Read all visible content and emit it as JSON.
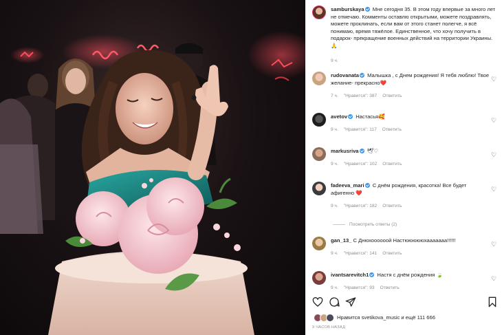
{
  "post": {
    "author": {
      "username": "samburskaya",
      "caption": "Мне сегодня 35. В этом году впервые за много лет не отмечаю. Комменты оставлю открытыми, можете поздравлять, можете проклинать, если вам от этого станет полегче, я всё понимаю, время тяжёлое. Единственное, что хочу получить в подарок- прекращение военных действий на территории Украины. 🙏",
      "time": "9 ч."
    },
    "comments": [
      {
        "username": "rudovanata",
        "text": "Малышка , с Днем рождения! Я тебя люблю! Твое желание- прекрасно❤️",
        "time": "7 ч.",
        "likes": "\"Нравится\": 387",
        "reply": "Ответить"
      },
      {
        "username": "avetov",
        "text": "Настасья🥰",
        "time": "9 ч.",
        "likes": "\"Нравится\": 117",
        "reply": "Ответить"
      },
      {
        "username": "markusriva",
        "text": "🕊♡",
        "time": "9 ч.",
        "likes": "\"Нравится\": 102",
        "reply": "Ответить"
      },
      {
        "username": "fadeeva_mari",
        "text": "С днём рождения, красотка! Все будет афигенно ❤️",
        "time": "9 ч.",
        "likes": "\"Нравится\": 182",
        "reply": "Ответить"
      },
      {
        "username": "gan_13_",
        "text": "С Днюхоооооой Настюююююхааааааа!!!!!!",
        "time": "9 ч.",
        "likes": "\"Нравится\": 141",
        "reply": "Ответить"
      },
      {
        "username": "ivantsarevitch1",
        "text": "Настя с днём рождения 🍃",
        "time": "9 ч.",
        "likes": "\"Нравится\": 93",
        "reply": "Ответить"
      }
    ],
    "view_replies": "Посмотреть ответы (2)",
    "likes_text": "Нравится svetikova_music и ещё 111 666",
    "posted_ago": "9 ЧАСОВ НАЗАД"
  },
  "icons": {
    "like": "heart-icon",
    "comment": "comment-icon",
    "share": "share-icon",
    "save": "bookmark-icon",
    "verified": "verified-badge-icon"
  },
  "colors": {
    "verified": "#3897f0",
    "meta": "#8e8e8e",
    "text": "#262626",
    "neon": "#ff3b4f",
    "dress": "#1e8a86",
    "roses": "#f3c7cf"
  }
}
